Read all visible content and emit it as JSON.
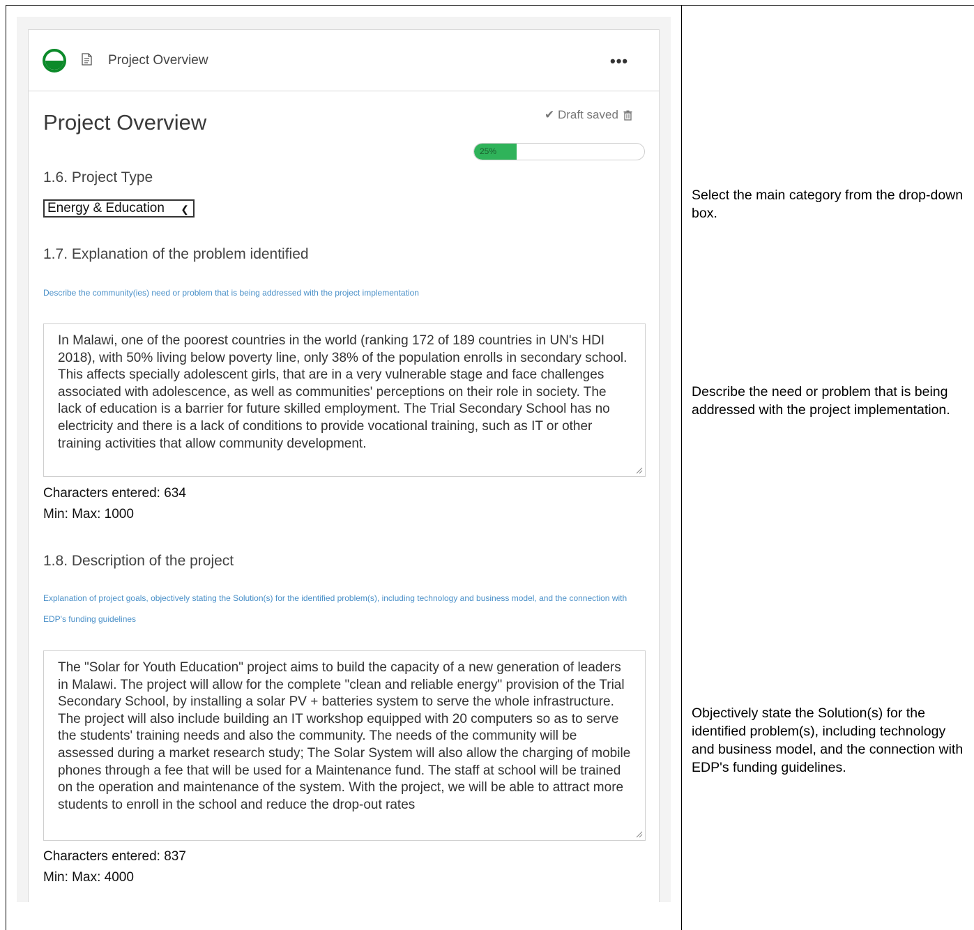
{
  "header": {
    "title": "Project Overview",
    "more": "•••"
  },
  "page_title": "Project Overview",
  "draft": {
    "status": "✔ Draft saved"
  },
  "progress": {
    "label": "25%",
    "value": 25
  },
  "q16": {
    "label": "1.6. Project Type",
    "selected": "Energy & Education"
  },
  "q17": {
    "label": "1.7. Explanation of the problem identified",
    "help": "Describe the community(ies) need or problem that is being addressed with the project implementation",
    "answer": "In Malawi, one of the poorest countries in the world (ranking 172 of 189 countries in UN's HDI 2018), with 50% living below poverty line, only 38% of the population enrolls in secondary school. This affects specially adolescent girls, that are in a very vulnerable stage and face challenges associated with adolescence, as well as communities' perceptions on their role in society. The lack of education is a barrier for future skilled employment. The Trial Secondary School has no electricity and there is a lack of conditions to provide vocational training, such as IT or other training activities that allow community development.",
    "chars": "Characters entered: 634",
    "limits": "Min: Max: 1000"
  },
  "q18": {
    "label": "1.8. Description of the project",
    "help": "Explanation of project goals, objectively stating the Solution(s) for the identified problem(s), including technology and business model, and the connection with EDP's funding guidelines",
    "answer": "The \"Solar for Youth Education\" project aims to build the capacity of a new generation of leaders in Malawi. The project will allow for the complete \"clean and reliable energy\" provision of the Trial Secondary School, by installing a solar PV + batteries system to serve the whole infrastructure. The project will also include building an IT workshop equipped with 20 computers so as to serve the students' training needs and also the community. The needs of the community will be assessed during a market research study; The Solar System will also allow the charging of mobile phones through a fee that will be used for a Maintenance fund. The staff at school will be trained on the operation and maintenance of the system. With the project, we will be able to attract more students to enroll in the school and reduce the drop-out rates",
    "chars": "Characters entered: 837",
    "limits": "Min: Max: 4000"
  },
  "notes": {
    "type": "Select the main category from the drop-down box.",
    "problem": "Describe the need or problem that is being addressed with the project implementation.",
    "description": "Objectively state the Solution(s) for the identified problem(s), including technology and business model, and the connection with EDP's funding guidelines."
  }
}
